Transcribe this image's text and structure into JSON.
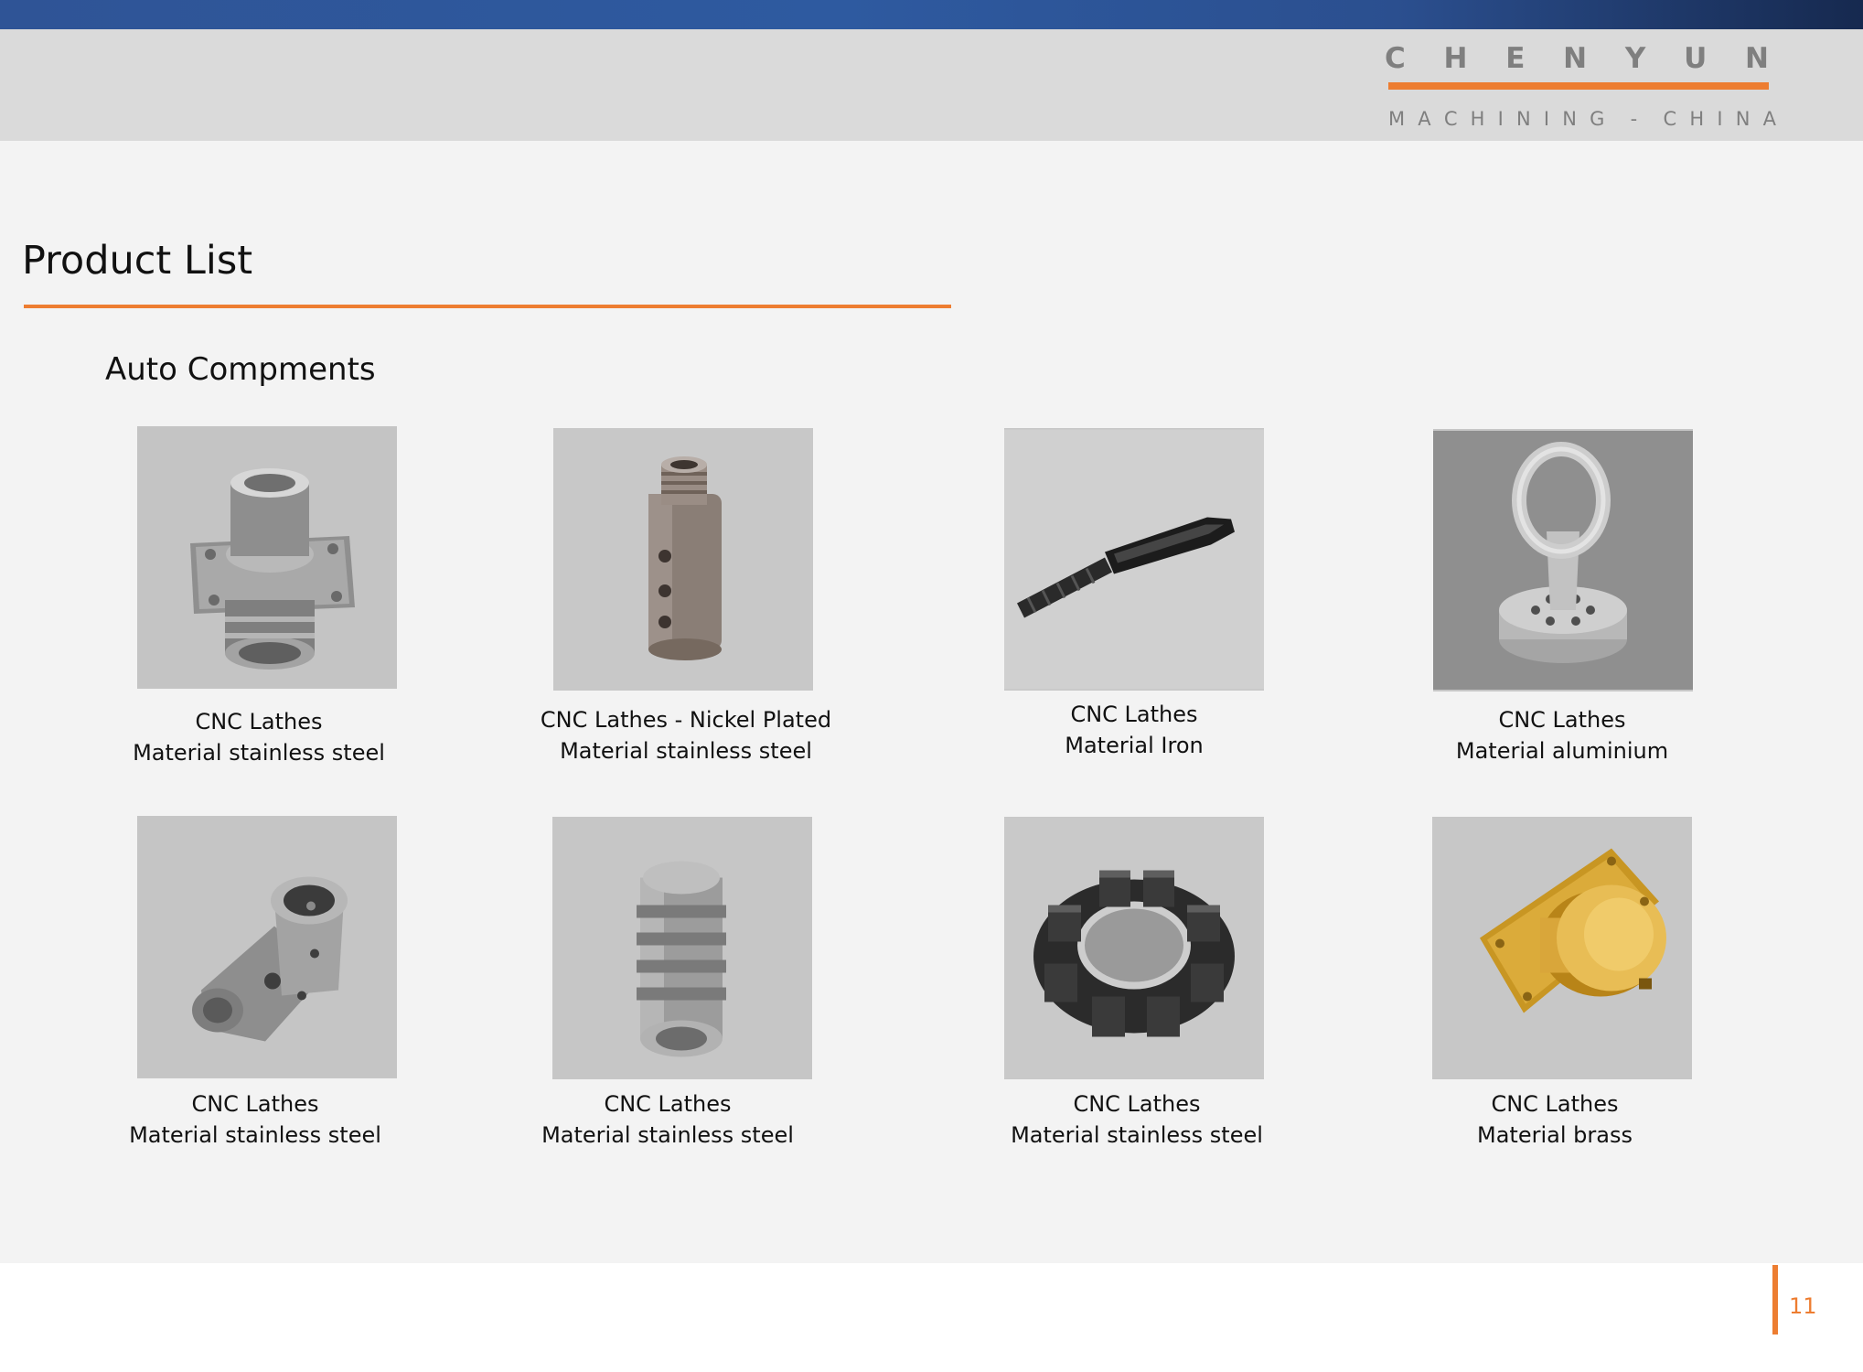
{
  "brand": {
    "name_letters": [
      "C",
      "H",
      "E",
      "N",
      "Y",
      "U",
      "N"
    ],
    "tagline_letters": [
      "M",
      "A",
      "C",
      "H",
      "I",
      "N",
      "I",
      "N",
      "G",
      "",
      "-",
      "",
      "C",
      "H",
      "I",
      "N",
      "A"
    ],
    "accent_color": "#ed7d31",
    "header_bar_color": "#2f5496"
  },
  "page": {
    "title": "Product List",
    "section": "Auto Compments",
    "number": "11"
  },
  "products": [
    {
      "line1": "CNC Lathes",
      "line2": "Material stainless steel",
      "image": "flange-connector-photo"
    },
    {
      "line1": "CNC Lathes  - Nickel Plated",
      "line2": "Material stainless steel",
      "image": "nickel-plated-fitting-photo"
    },
    {
      "line1": "CNC Lathes",
      "line2": "Material Iron",
      "image": "iron-threaded-rod-photo"
    },
    {
      "line1": "CNC Lathes",
      "line2": "Material aluminium",
      "image": "aluminium-ring-mount-photo"
    },
    {
      "line1": "CNC Lathes",
      "line2": "Material stainless steel",
      "image": "angled-elbow-fitting-photo"
    },
    {
      "line1": "CNC Lathes",
      "line2": "Material stainless steel",
      "image": "grooved-spool-photo"
    },
    {
      "line1": "CNC Lathes",
      "line2": "Material stainless steel",
      "image": "segmented-ring-photo"
    },
    {
      "line1": "CNC Lathes",
      "line2": "Material brass",
      "image": "brass-flange-cap-photo"
    }
  ]
}
